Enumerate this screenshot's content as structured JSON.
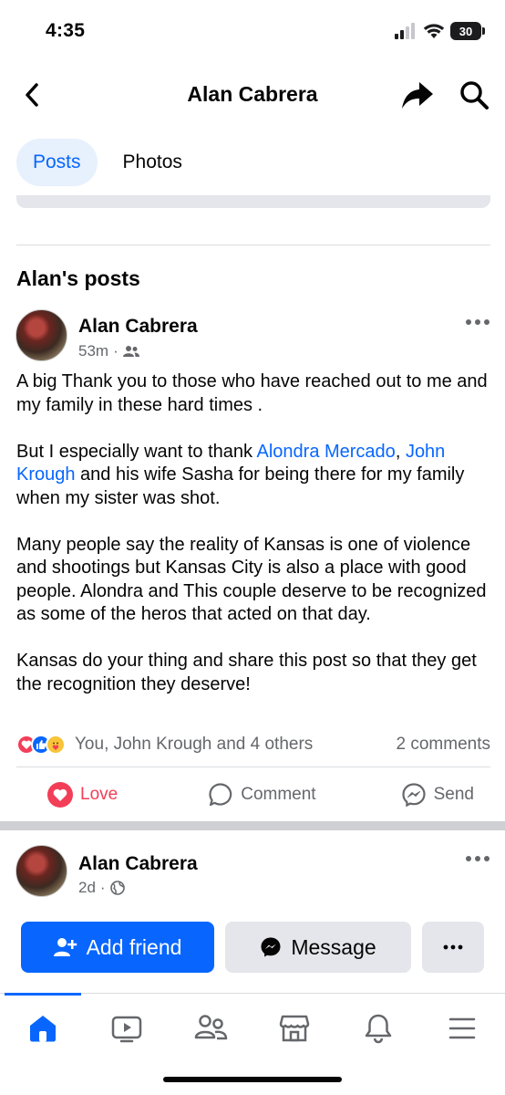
{
  "status_bar": {
    "time": "4:35",
    "battery": "30"
  },
  "nav": {
    "title": "Alan Cabrera",
    "back_icon": "chevron-left-icon",
    "share_icon": "share-arrow-icon",
    "search_icon": "search-icon"
  },
  "tabs": [
    {
      "label": "Posts",
      "active": true
    },
    {
      "label": "Photos",
      "active": false
    }
  ],
  "section_title": "Alan's posts",
  "post": {
    "author": "Alan Cabrera",
    "time": "53m",
    "audience_icon": "friends-icon",
    "body": {
      "p1": "A big Thank you to those who have reached out to me and my family in these hard times .",
      "p2_before": "But I especially want to thank ",
      "p2_link1": "Alondra Mercado",
      "p2_sep": ", ",
      "p2_link2": "John Krough",
      "p2_after": " and his wife Sasha for being there for my family when my sister was shot.",
      "p3": "Many people say the reality of Kansas is one of violence and shootings but Kansas City is also a place with good people. Alondra and This couple deserve to be recognized as some of the heros that acted on that day.",
      "p4": "Kansas do your thing and share this post so that they get the recognition they deserve!"
    },
    "reactions_text": "You, John  Krough and 4 others",
    "comments_count": "2 comments",
    "actions": {
      "love": "Love",
      "comment": "Comment",
      "send": "Send"
    }
  },
  "post2": {
    "author": "Alan Cabrera",
    "time": "2d",
    "audience_icon": "globe-icon"
  },
  "buttons": {
    "add_friend": "Add friend",
    "message": "Message"
  },
  "colors": {
    "accent": "#0866ff",
    "love": "#f33e58",
    "muted": "#65676b"
  },
  "bottom_nav": [
    "home-icon",
    "video-icon",
    "friends-icon",
    "marketplace-icon",
    "bell-icon",
    "menu-icon"
  ]
}
